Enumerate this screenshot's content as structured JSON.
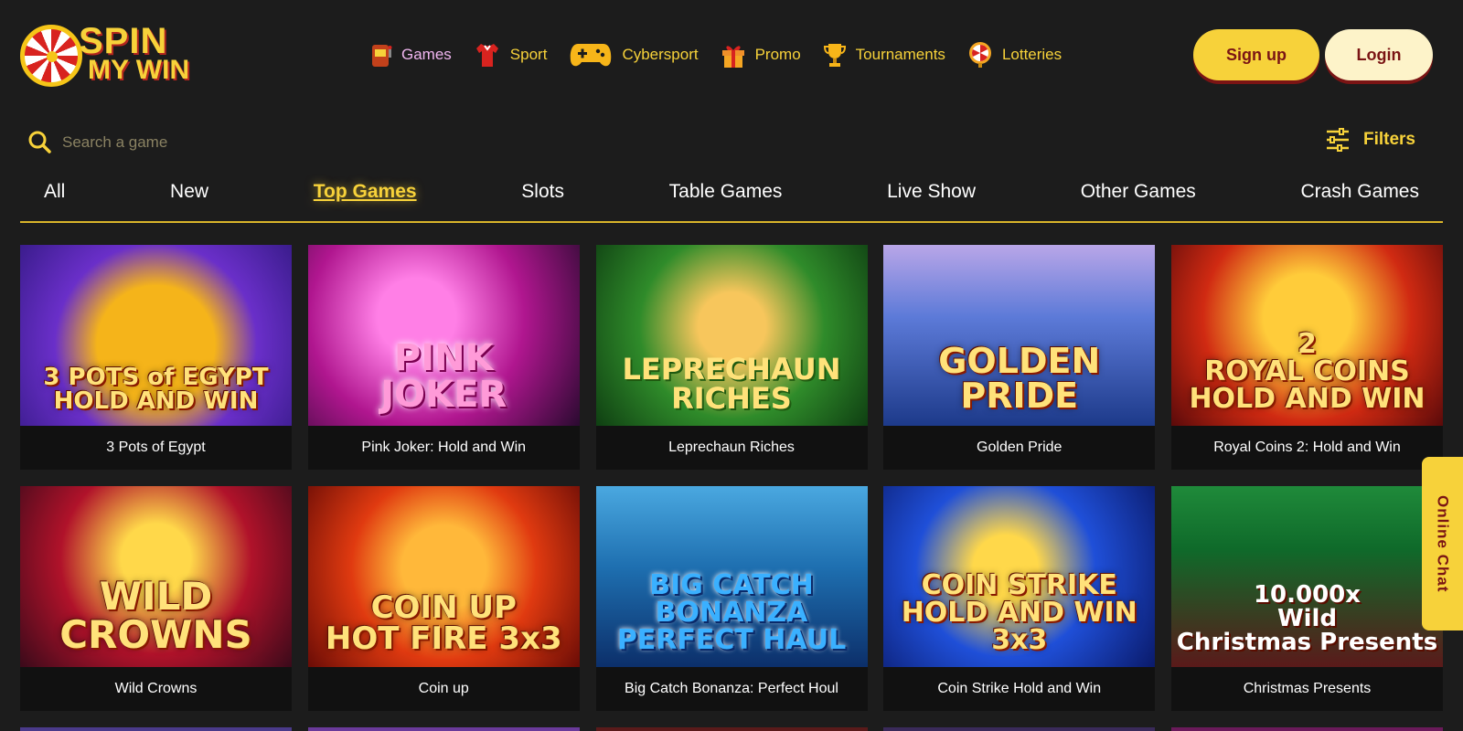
{
  "brand": {
    "line1": "SPIN",
    "line2": "MY WIN"
  },
  "nav": [
    {
      "label": "Games",
      "icon": "slot-machine-icon",
      "active": true
    },
    {
      "label": "Sport",
      "icon": "jersey-icon",
      "active": false
    },
    {
      "label": "Cybersport",
      "icon": "gamepad-icon",
      "active": false
    },
    {
      "label": "Promo",
      "icon": "gift-icon",
      "active": false
    },
    {
      "label": "Tournaments",
      "icon": "trophy-icon",
      "active": false
    },
    {
      "label": "Lotteries",
      "icon": "wheel-icon",
      "active": false
    }
  ],
  "auth": {
    "signup": "Sign up",
    "login": "Login"
  },
  "search": {
    "placeholder": "Search a game"
  },
  "filters": {
    "label": "Filters"
  },
  "tabs": [
    {
      "label": "All",
      "active": false
    },
    {
      "label": "New",
      "active": false
    },
    {
      "label": "Top Games",
      "active": true
    },
    {
      "label": "Slots",
      "active": false
    },
    {
      "label": "Table Games",
      "active": false
    },
    {
      "label": "Live Show",
      "active": false
    },
    {
      "label": "Other Games",
      "active": false
    },
    {
      "label": "Crash Games",
      "active": false
    }
  ],
  "games": [
    {
      "name": "3 Pots of Egypt",
      "art": "3 POTS of EGYPT\nHOLD AND WIN"
    },
    {
      "name": "Pink Joker: Hold and Win",
      "art": "PINK\nJOKER"
    },
    {
      "name": "Leprechaun Riches",
      "art": "LEPRECHAUN\nRICHES"
    },
    {
      "name": "Golden Pride",
      "art": "GOLDEN\nPRIDE"
    },
    {
      "name": "Royal Coins 2: Hold and Win",
      "art": "2\nROYAL COINS\nHOLD AND WIN"
    },
    {
      "name": "Wild Crowns",
      "art": "WILD\nCROWNS"
    },
    {
      "name": "Coin up",
      "art": "COIN UP\nHOT FIRE 3x3"
    },
    {
      "name": "Big Catch Bonanza: Perfect Houl",
      "art": "BIG CATCH\nBONANZA PERFECT HAUL"
    },
    {
      "name": "Coin Strike Hold and Win",
      "art": "COIN STRIKE\nHOLD AND WIN 3x3"
    },
    {
      "name": "Christmas Presents",
      "art": "10.000x\nWild\nChristmas Presents"
    }
  ],
  "chat": {
    "label": "Online Chat"
  },
  "colors": {
    "accent": "#f7d23a",
    "background": "#1c1c1c",
    "card": "#111111",
    "brand_red": "#7a1414"
  }
}
